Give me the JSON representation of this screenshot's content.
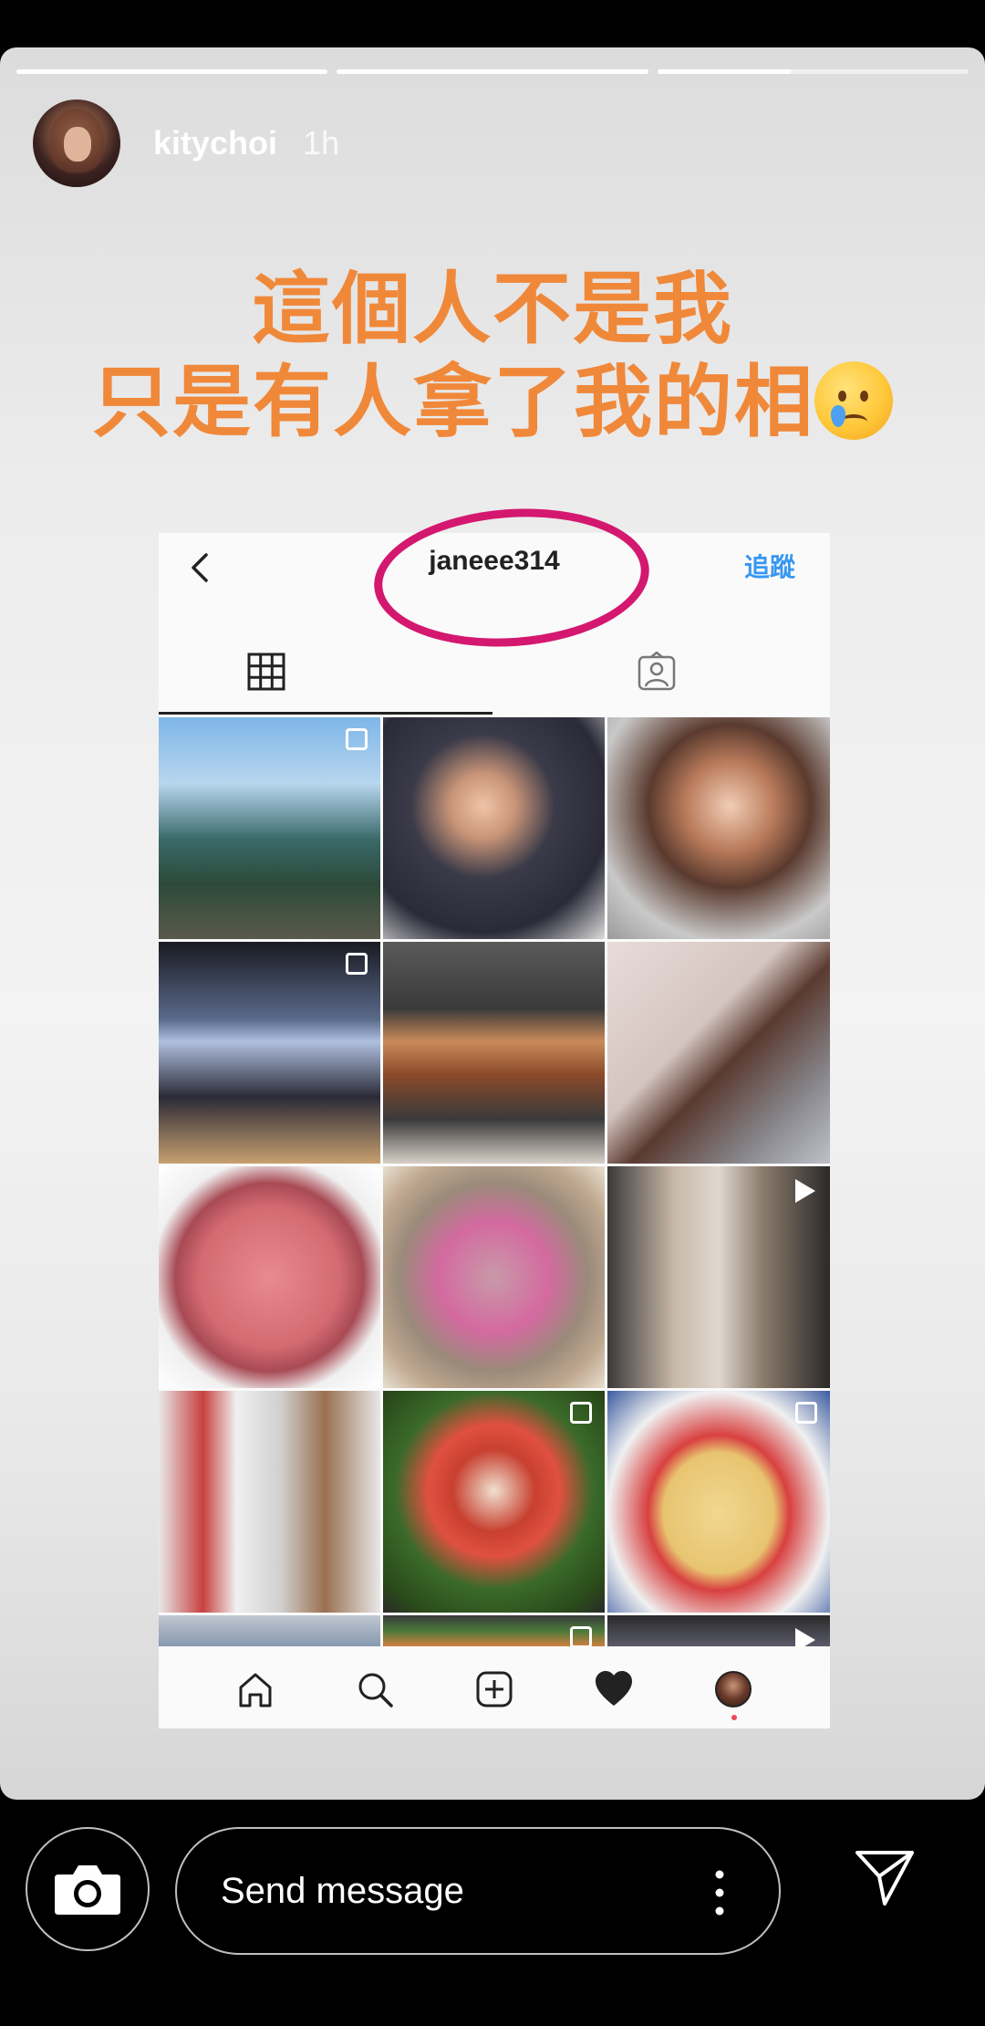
{
  "story": {
    "progress": [
      1.0,
      1.0,
      0.43
    ],
    "username": "kitychoi",
    "time": "1h",
    "caption_line1": "這個人不是我",
    "caption_line2": "只是有人拿了我的相",
    "caption_emoji": "crying-face-emoji"
  },
  "screenshot": {
    "profile_username": "janeee314",
    "follow_label": "追蹤",
    "highlight_color": "#d4186f",
    "posts": [
      {
        "desc": "harbour-street-sign",
        "badge": "multi"
      },
      {
        "desc": "woman-selfie-maruko-shirt",
        "badge": ""
      },
      {
        "desc": "woman-hand-on-face",
        "badge": ""
      },
      {
        "desc": "espresso-machine",
        "badge": "multi"
      },
      {
        "desc": "grilled-squid",
        "badge": ""
      },
      {
        "desc": "woman-long-hair-back",
        "badge": ""
      },
      {
        "desc": "pink-macaron",
        "badge": ""
      },
      {
        "desc": "macarons-tray",
        "badge": ""
      },
      {
        "desc": "people-with-headphones",
        "badge": "video"
      },
      {
        "desc": "building-facade",
        "badge": ""
      },
      {
        "desc": "tomato-salad-rose",
        "badge": "multi"
      },
      {
        "desc": "strawberry-crepe-cake",
        "badge": "multi"
      },
      {
        "desc": "partial-post",
        "badge": ""
      },
      {
        "desc": "partial-post",
        "badge": "multi"
      },
      {
        "desc": "partial-post",
        "badge": "video"
      }
    ]
  },
  "reply": {
    "placeholder": "Send message"
  },
  "colors": {
    "caption": "#f0883a",
    "follow": "#3897f0",
    "background": "#000000"
  }
}
